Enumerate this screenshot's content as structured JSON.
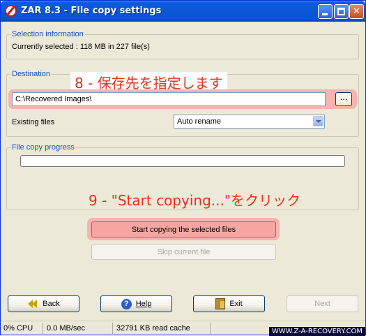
{
  "window": {
    "title": "ZAR 8.3 - File copy settings"
  },
  "selection": {
    "group_title": "Selection information",
    "summary": "Currently selected : 118 MB in 227 file(s)"
  },
  "destination": {
    "group_title": "Destination",
    "annotation": "8 - 保存先を指定します",
    "path_value": "C:\\Recovered Images\\",
    "browse_label": "...",
    "existing_label": "Existing files",
    "existing_selected": "Auto rename"
  },
  "progress": {
    "group_title": "File copy progress",
    "annotation": "9 - \"Start copying...\"をクリック",
    "percent": 0
  },
  "actions": {
    "start_label": "Start copying the selected files",
    "skip_label": "Skip current file"
  },
  "footer": {
    "back_label": "Back",
    "help_label": "Help",
    "exit_label": "Exit",
    "next_label": "Next"
  },
  "status": {
    "cpu": "0% CPU",
    "speed": "0.0 MB/sec",
    "cache": "32791 KB read cache"
  },
  "watermark": "WWW.Z-A-RECOVERY.COM",
  "icons": [
    "app-logo-icon",
    "minimize-icon",
    "maximize-icon",
    "close-icon",
    "back-arrows-icon",
    "help-icon",
    "exit-door-icon",
    "dropdown-arrow-icon"
  ]
}
